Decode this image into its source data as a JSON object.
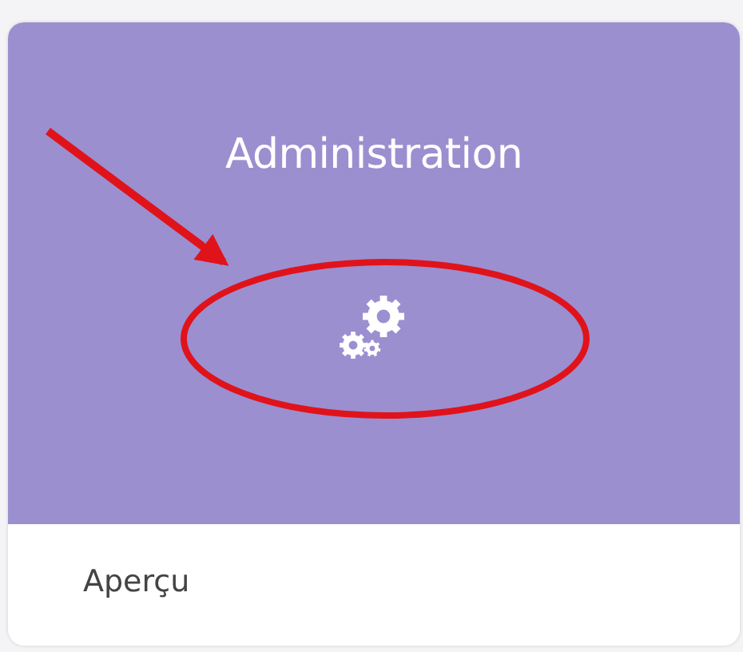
{
  "card": {
    "title": "Administration",
    "footer": "Aperçu"
  }
}
